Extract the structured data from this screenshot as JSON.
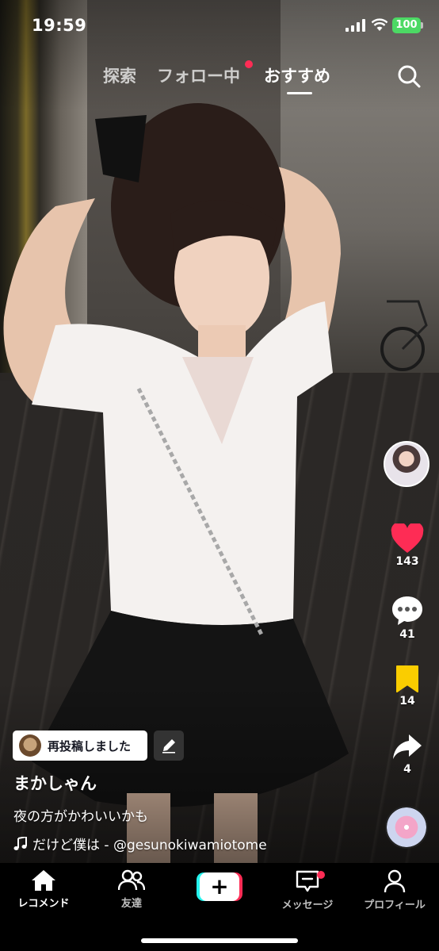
{
  "status_bar": {
    "time": "19:59",
    "battery": "100"
  },
  "top_tabs": {
    "explore": "探索",
    "following": "フォロー中",
    "for_you": "おすすめ",
    "active": "おすすめ"
  },
  "video": {
    "repost_label": "再投稿しました",
    "username": "まかしゃん",
    "caption": "夜の方がかわいいかも",
    "sound": "だけど僕は - @gesunokiwamiotome"
  },
  "actions": {
    "likes": "143",
    "comments": "41",
    "bookmarks": "14",
    "shares": "4"
  },
  "bottom_nav": {
    "home": "レコメンド",
    "friends": "友達",
    "create": "+",
    "inbox": "メッセージ",
    "profile": "プロフィール"
  },
  "colors": {
    "like": "#fe2c55",
    "bookmark": "#facd00",
    "accent_cyan": "#25f4ee",
    "battery": "#4cd964"
  }
}
